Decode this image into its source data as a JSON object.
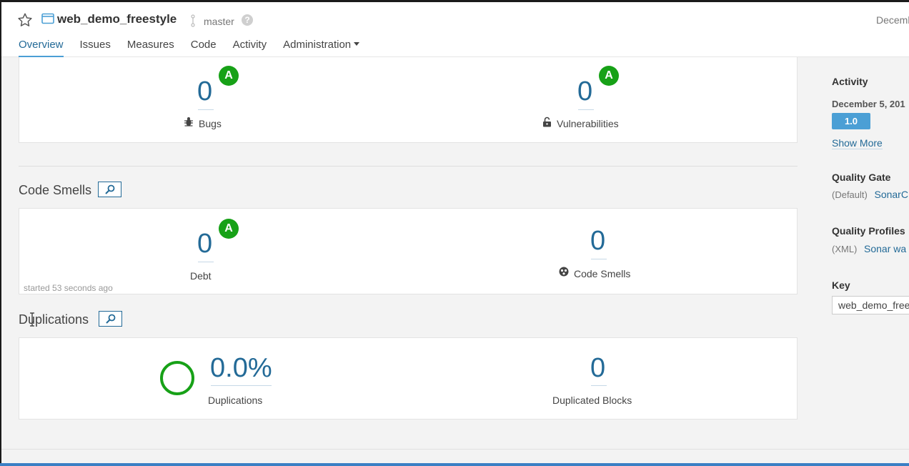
{
  "header": {
    "project_name": "web_demo_freestyle",
    "branch": "master",
    "help": "?",
    "date": "Decemb"
  },
  "nav": {
    "items": [
      {
        "label": "Overview",
        "active": true
      },
      {
        "label": "Issues"
      },
      {
        "label": "Measures"
      },
      {
        "label": "Code"
      },
      {
        "label": "Activity"
      },
      {
        "label": "Administration"
      }
    ]
  },
  "reliability": {
    "bugs": {
      "value": "0",
      "rating": "A",
      "label": "Bugs"
    },
    "vulnerabilities": {
      "value": "0",
      "rating": "A",
      "label": "Vulnerabilities"
    }
  },
  "code_smells_section": {
    "title": "Code Smells",
    "debt": {
      "value": "0",
      "rating": "A",
      "label": "Debt"
    },
    "smells": {
      "value": "0",
      "label": "Code Smells"
    },
    "started": "started 53 seconds ago"
  },
  "duplications_section": {
    "title": "Duplications",
    "duplications": {
      "value": "0.0%",
      "label": "Duplications"
    },
    "blocks": {
      "value": "0",
      "label": "Duplicated Blocks"
    }
  },
  "sidebar": {
    "activity_title": "Activity",
    "activity_date": "December 5, 201",
    "version": "1.0",
    "show_more": "Show More",
    "quality_gate_title": "Quality Gate",
    "quality_gate_prefix": "(Default)",
    "quality_gate_link": "SonarC",
    "quality_profiles_title": "Quality Profiles",
    "quality_profiles_prefix": "(XML)",
    "quality_profiles_link": "Sonar wa",
    "key_title": "Key",
    "key_value": "web_demo_freestyle"
  },
  "colors": {
    "accent": "#236a97",
    "rating_a": "#17a117",
    "badge": "#4b9fd5"
  }
}
